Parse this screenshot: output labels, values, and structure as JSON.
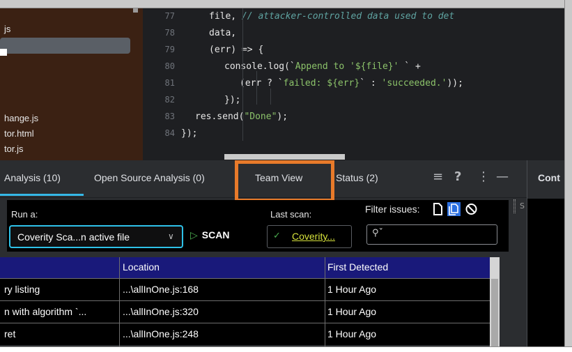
{
  "sidebar": {
    "items": [
      {
        "label": "js"
      },
      {
        "label": "hange.js"
      },
      {
        "label": "tor.html"
      },
      {
        "label": "tor.js"
      }
    ]
  },
  "editor": {
    "lines": [
      {
        "num": "77",
        "parts": [
          [
            "code",
            "file, "
          ],
          [
            "comment",
            "// attacker-controlled data used to det"
          ]
        ]
      },
      {
        "num": "78",
        "parts": [
          [
            "code",
            "data,"
          ]
        ]
      },
      {
        "num": "79",
        "parts": [
          [
            "code",
            "(err) => {"
          ]
        ]
      },
      {
        "num": "80",
        "parts": [
          [
            "code",
            "console.log(`"
          ],
          [
            "str",
            "Append to '${file}' "
          ],
          [
            "code",
            "` +"
          ]
        ]
      },
      {
        "num": "81",
        "parts": [
          [
            "code",
            "(err ? `"
          ],
          [
            "str",
            "failed: ${err}"
          ],
          [
            "code",
            "` : "
          ],
          [
            "str",
            "'succeeded.'"
          ],
          [
            "code",
            "));"
          ]
        ]
      },
      {
        "num": "82",
        "parts": [
          [
            "code",
            "});"
          ]
        ]
      },
      {
        "num": "83",
        "parts": [
          [
            "code",
            "res.send("
          ],
          [
            "str",
            "\"Done\""
          ],
          [
            "code",
            ");"
          ]
        ]
      },
      {
        "num": "84",
        "parts": [
          [
            "code",
            "});"
          ]
        ]
      }
    ]
  },
  "tabs": {
    "analysis": "Analysis (10)",
    "open_source": "Open Source Analysis (0)",
    "team_view": "Team View",
    "status": "Status (2)",
    "cont": "Cont"
  },
  "scan": {
    "run_label": "Run a:",
    "run_value": "Coverity Sca...n active file",
    "scan_button": "SCAN",
    "last_scan_label": "Last scan:",
    "last_scan_link": "Coverity...",
    "filter_label": "Filter issues:",
    "search_placeholder": ""
  },
  "table": {
    "headers": [
      "",
      "Location",
      "First Detected"
    ],
    "rows": [
      [
        "ry listing",
        "...\\allInOne.js:168",
        "1 Hour Ago"
      ],
      [
        "n with algorithm `...",
        "...\\allInOne.js:320",
        "1 Hour Ago"
      ],
      [
        "ret",
        "...\\allInOne.js:248",
        "1 Hour Ago"
      ]
    ]
  },
  "colors": {
    "accent": "#35b8e8",
    "highlight_box": "#e87a2a",
    "table_header": "#19197a",
    "scan_link": "#d7e33c"
  }
}
